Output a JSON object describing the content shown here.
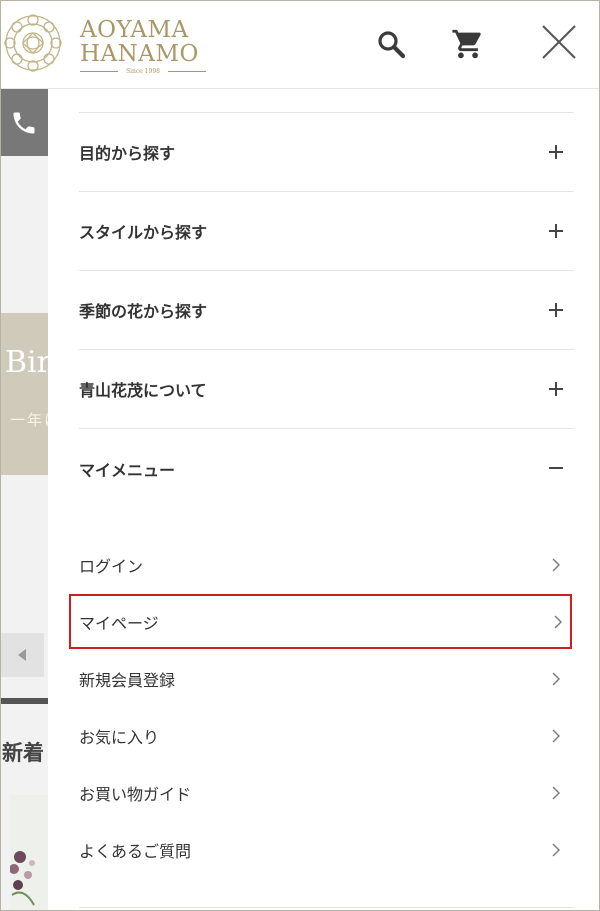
{
  "brand": {
    "line1": "AOYAMA",
    "line2": "HANAMO",
    "since": "Since 1998",
    "accent": "#a89767"
  },
  "header": {
    "search_icon": "search-icon",
    "cart_icon": "cart-icon",
    "close_icon": "close-icon"
  },
  "background_page": {
    "phone_icon": "phone-icon",
    "hero_title": "Birthday",
    "hero_subtitle": "一年に一度の",
    "news_title": "新着",
    "prev_icon": "triangle-left-icon"
  },
  "menu": {
    "categories": [
      {
        "label": "目的から探す",
        "state": "collapsed"
      },
      {
        "label": "スタイルから探す",
        "state": "collapsed"
      },
      {
        "label": "季節の花から探す",
        "state": "collapsed"
      },
      {
        "label": "青山花茂について",
        "state": "collapsed"
      },
      {
        "label": "マイメニュー",
        "state": "expanded"
      }
    ],
    "my_menu": [
      {
        "label": "ログイン"
      },
      {
        "label": "マイページ",
        "highlighted": true,
        "highlight_color": "#cc1f1f"
      },
      {
        "label": "新規会員登録"
      },
      {
        "label": "お気に入り"
      },
      {
        "label": "お買い物ガイド"
      },
      {
        "label": "よくあるご質問"
      }
    ]
  }
}
